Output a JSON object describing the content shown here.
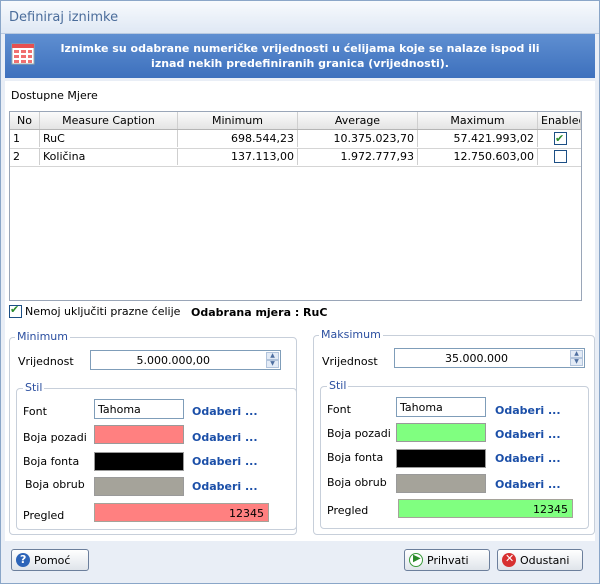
{
  "window": {
    "title": "Definiraj iznimke"
  },
  "banner": {
    "message": "Iznimke su odabrane numeričke vrijednosti u ćelijama koje se nalaze ispod ili iznad nekih predefiniranih granica (vrijednosti)."
  },
  "measures": {
    "label": "Dostupne Mjere",
    "columns": [
      "No",
      "Measure Caption",
      "Minimum",
      "Average",
      "Maximum",
      "Enabled"
    ],
    "rows": [
      {
        "no": "1",
        "caption": "RuC",
        "min": "698.544,23",
        "avg": "10.375.023,70",
        "max": "57.421.993,02",
        "enabled": true
      },
      {
        "no": "2",
        "caption": "Količina",
        "min": "137.113,00",
        "avg": "1.972.777,93",
        "max": "12.750.603,00",
        "enabled": false
      }
    ]
  },
  "options": {
    "exclude_empty_label": "Nemoj uključiti prazne ćelije",
    "exclude_empty_checked": true,
    "selected_measure": "Odabrana mjera : RuC"
  },
  "minimum": {
    "title": "Minimum",
    "value_label": "Vrijednost",
    "value": "5.000.000,00",
    "style_title": "Stil",
    "font_label": "Font",
    "font_value": "Tahoma",
    "bg_label": "Boja pozadi",
    "fontcolor_label": "Boja fonta",
    "border_label": "Boja obrub",
    "preview_label": "Pregled",
    "preview_text": "12345",
    "choose": "Odaberi ...",
    "colors": {
      "bg": "#ff8080",
      "font": "#000000",
      "border": "#a5a39a"
    }
  },
  "maximum": {
    "title": "Maksimum",
    "value_label": "Vrijednost",
    "value": "35.000.000",
    "style_title": "Stil",
    "font_label": "Font",
    "font_value": "Tahoma",
    "bg_label": "Boja pozadi",
    "fontcolor_label": "Boja fonta",
    "border_label": "Boja obrub",
    "preview_label": "Pregled",
    "preview_text": "12345",
    "choose": "Odaberi ...",
    "colors": {
      "bg": "#80ff80",
      "font": "#000000",
      "border": "#a5a39a"
    }
  },
  "footer": {
    "help": "Pomoć",
    "accept": "Prihvati",
    "cancel": "Odustani"
  }
}
